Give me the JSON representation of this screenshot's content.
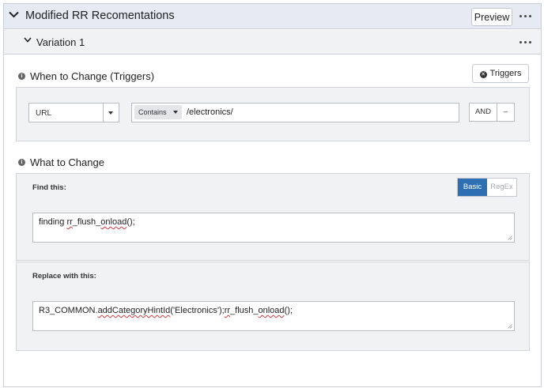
{
  "header": {
    "title": "Modified RR Recomentations",
    "preview_label": "Preview"
  },
  "variation": {
    "title": "Variation 1"
  },
  "triggers": {
    "section_title": "When to Change (Triggers)",
    "button_label": "Triggers",
    "type_select": "URL",
    "operator": "Contains",
    "value": "/electronics/",
    "and_label": "AND",
    "remove_label": "–"
  },
  "changes": {
    "section_title": "What to Change",
    "find_label": "Find this:",
    "mode_basic": "Basic",
    "mode_regex": "RegEx",
    "active_mode": "Basic",
    "find_value": {
      "p1": "finding ",
      "w1": "rr",
      "p2": "_flush_",
      "w2": "onload",
      "p3": "();"
    },
    "replace_label": "Replace with this:",
    "replace_value": {
      "p1": "R3_COMMON.",
      "w1": "addCategoryHintId",
      "p2": "('Electronics');",
      "w2": "rr",
      "p3": "_flush_",
      "w3": "onload",
      "p4": "();"
    }
  },
  "colors": {
    "header_bg": "#e6ebf3",
    "accent": "#2e6fb3",
    "panel_bg": "#f1f2f4"
  }
}
